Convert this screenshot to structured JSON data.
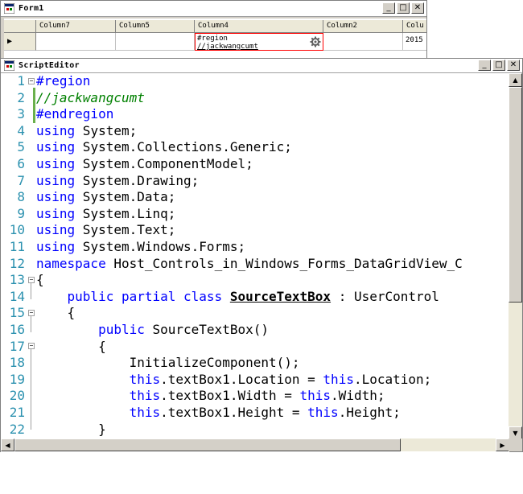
{
  "form1": {
    "title": "Form1",
    "controls": {
      "minimize": "_",
      "maximize": "□",
      "close": "✕"
    },
    "grid": {
      "columns": [
        "Column7",
        "Column5",
        "Column4",
        "Column2",
        "Colu"
      ],
      "row": {
        "indicator": "▶",
        "cells": [
          "",
          "",
          "",
          "",
          "2015"
        ],
        "editing_lines": [
          "#region",
          "//jackwangcumt"
        ]
      }
    }
  },
  "editor": {
    "title": "ScriptEditor",
    "controls": {
      "minimize": "_",
      "maximize": "□",
      "close": "✕"
    },
    "line_numbers": [
      "1",
      "2",
      "3",
      "4",
      "5",
      "6",
      "7",
      "8",
      "9",
      "10",
      "11",
      "12",
      "13",
      "14",
      "15",
      "16",
      "17",
      "18",
      "19",
      "20",
      "21",
      "22"
    ],
    "code": {
      "l1": "#region",
      "l2": "//jackwangcumt",
      "l3": "#endregion",
      "using": "using",
      "l4": " System;",
      "l5": " System.Collections.Generic;",
      "l6": " System.ComponentModel;",
      "l7": " System.Drawing;",
      "l8": " System.Data;",
      "l9": " System.Linq;",
      "l10": " System.Text;",
      "l11": " System.Windows.Forms;",
      "l12_kw": "namespace",
      "l12": " Host_Controls_in_Windows_Forms_DataGridView_C",
      "l13": "{",
      "l14_indent": "    ",
      "l14_kw": "public partial class",
      "l14_sp": " ",
      "l14_name": "SourceTextBox",
      "l14_rest": " : UserControl",
      "l15": "    {",
      "l16_indent": "        ",
      "l16_kw": "public",
      "l16_rest": " SourceTextBox()",
      "l17": "        {",
      "l18": "            InitializeComponent();",
      "l19_indent": "            ",
      "this": "this",
      "l19_a": ".textBox1.Location = ",
      "l19_b": ".Location;",
      "l20_a": ".textBox1.Width = ",
      "l20_b": ".Width;",
      "l21_a": ".textBox1.Height = ",
      "l21_b": ".Height;",
      "l22": "        }"
    },
    "scroll": {
      "up": "▲",
      "down": "▼",
      "left": "◀",
      "right": "▶"
    }
  },
  "colors": {
    "keyword": "#0000ff",
    "comment": "#008000",
    "line_number": "#2b91af",
    "edit_border": "#ff0000"
  }
}
